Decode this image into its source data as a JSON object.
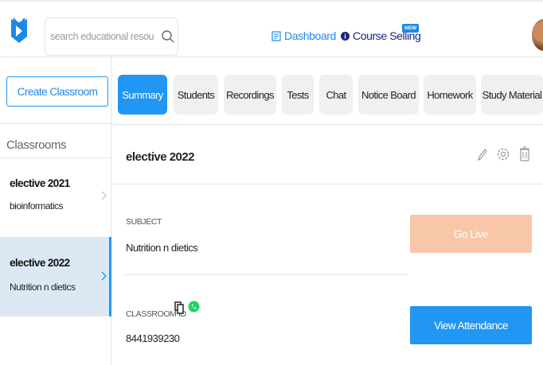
{
  "header": {
    "search": {
      "placeholder": "search educational resources"
    },
    "nav": {
      "dashboard_label": "Dashboard",
      "course_selling_label": "Course Selling",
      "new_badge": "NEW"
    }
  },
  "sidebar": {
    "create_button_label": "Create Classroom",
    "classrooms_title": "Classrooms",
    "items": [
      {
        "name": "elective 2021",
        "subject": "bioinformatics",
        "active": false
      },
      {
        "name": "elective 2022",
        "subject": "Nutrition n dietics",
        "active": true
      }
    ]
  },
  "tabs": [
    {
      "label": "Summary",
      "active": true
    },
    {
      "label": "Students",
      "active": false
    },
    {
      "label": "Recordings",
      "active": false
    },
    {
      "label": "Tests",
      "active": false
    },
    {
      "label": "Chat",
      "active": false
    },
    {
      "label": "Notice Board",
      "active": false
    },
    {
      "label": "Homework",
      "active": false
    },
    {
      "label": "Study Material",
      "active": false
    }
  ],
  "main": {
    "classroom_title": "elective 2022",
    "subject_label": "SUBJECT",
    "subject_value": "Nutrition n dietics",
    "classroom_id_label": "CLASSROOM ID",
    "classroom_id_value": "8441939230",
    "go_live_label": "Go Live",
    "view_attendance_label": "View Attendance"
  },
  "colors": {
    "accent": "#2196f3",
    "go_live_bg": "#f8c6a8",
    "active_item_bg": "#dce9f5",
    "whatsapp": "#25d366"
  }
}
